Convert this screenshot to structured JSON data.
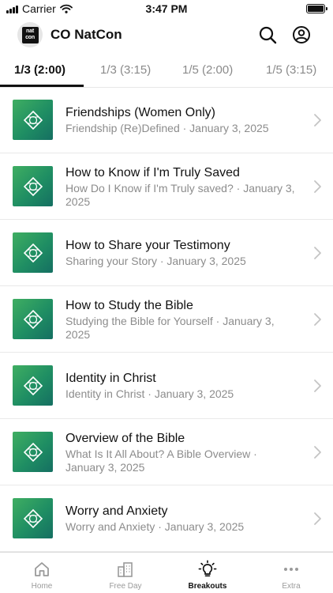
{
  "status_bar": {
    "carrier": "Carrier",
    "time": "3:47 PM"
  },
  "header": {
    "title": "CO NatCon",
    "logo_line1": "nat",
    "logo_line2": "con"
  },
  "tabs": [
    {
      "label": "1/3 (2:00)",
      "active": true
    },
    {
      "label": "1/3 (3:15)",
      "active": false
    },
    {
      "label": "1/5 (2:00)",
      "active": false
    },
    {
      "label": "1/5 (3:15)",
      "active": false
    }
  ],
  "items": [
    {
      "title": "Friendships (Women Only)",
      "subtitle": "Friendship (Re)Defined · January 3, 2025"
    },
    {
      "title": "How to Know if I'm Truly Saved",
      "subtitle": "How Do I Know if I'm Truly saved? · January 3, 2025"
    },
    {
      "title": "How to Share your Testimony",
      "subtitle": "Sharing your Story · January 3, 2025"
    },
    {
      "title": "How to Study the Bible",
      "subtitle": "Studying the Bible for Yourself · January 3, 2025"
    },
    {
      "title": "Identity in Christ",
      "subtitle": "Identity in Christ · January 3, 2025"
    },
    {
      "title": "Overview of the Bible",
      "subtitle": "What Is It All About? A Bible Overview · January 3, 2025"
    },
    {
      "title": "Worry and Anxiety",
      "subtitle": "Worry and Anxiety · January 3, 2025"
    }
  ],
  "bottom_nav": [
    {
      "label": "Home",
      "icon": "home-icon",
      "active": false
    },
    {
      "label": "Free Day",
      "icon": "city-icon",
      "active": false
    },
    {
      "label": "Breakouts",
      "icon": "lightbulb-icon",
      "active": true
    },
    {
      "label": "Extra",
      "icon": "more-icon",
      "active": false
    }
  ],
  "colors": {
    "accent": "#111111",
    "thumb_green": "#2a9a63",
    "muted_text": "#8c8c8c"
  }
}
